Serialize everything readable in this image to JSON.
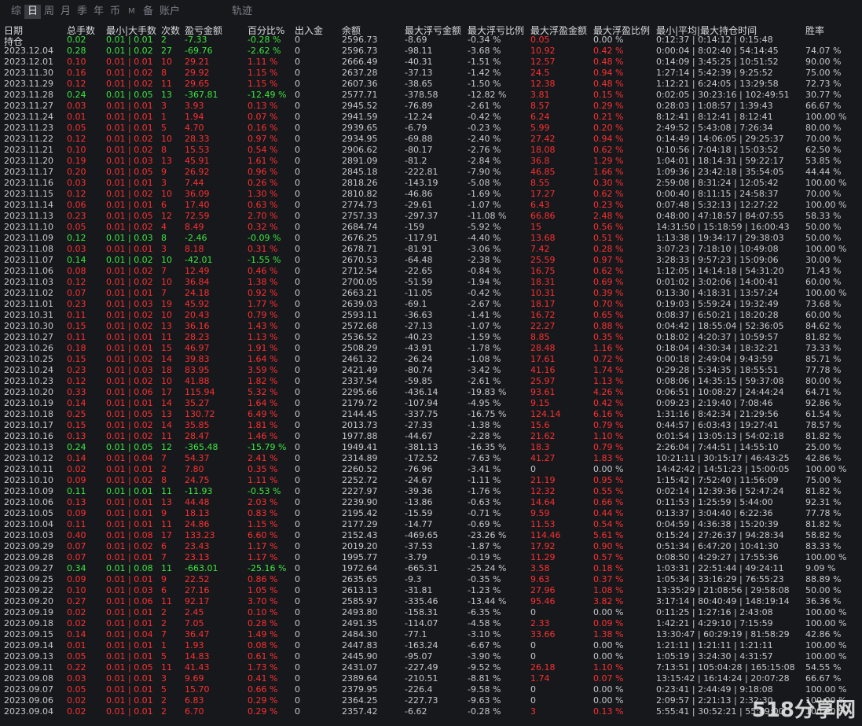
{
  "tabs": [
    "综",
    "日",
    "周",
    "月",
    "季",
    "年",
    "币",
    "M",
    "备",
    "账户",
    "轨迹"
  ],
  "active_tab": "日",
  "headers": [
    "日期",
    "总手数",
    "最小|大手数",
    "次数",
    "盈亏金额",
    "百分比%",
    "出入金",
    "余额",
    "最大浮亏金额",
    "最大浮亏比例",
    "最大浮盈金额",
    "最大浮盈比例",
    "最小|平均|最大持仓时间",
    "胜率"
  ],
  "holding": {
    "label": "持仓",
    "lots": "0.02",
    "minmax": "0.01 | 0.01",
    "count": "2",
    "pnl": "-7.33",
    "pct": "-0.28 %",
    "io": "0",
    "bal": "2596.73",
    "mfl": "-8.69",
    "mflp": "-0.34 %",
    "mfp": "0.05",
    "mfpp": "0.00 %",
    "time": "0:12:37 | 0:14:12 | 0:15:48",
    "win": ""
  },
  "rows": [
    [
      "2023.12.04",
      "0.28",
      "0.01 | 0.02",
      "27",
      "-69.76",
      "-2.62 %",
      "0",
      "2596.73",
      "-98.11",
      "-3.68 %",
      "10.92",
      "0.42 %",
      "0:00:04 | 8:02:40 | 54:14:45",
      "74.07 %"
    ],
    [
      "2023.12.01",
      "0.10",
      "0.01 | 0.01",
      "10",
      "29.21",
      "1.11 %",
      "0",
      "2666.49",
      "-40.31",
      "-1.51 %",
      "12.57",
      "0.48 %",
      "0:14:09 | 3:45:25 | 10:51:52",
      "90.00 %"
    ],
    [
      "2023.11.30",
      "0.16",
      "0.01 | 0.02",
      "8",
      "29.92",
      "1.15 %",
      "0",
      "2637.28",
      "-37.13",
      "-1.42 %",
      "24.5",
      "0.94 %",
      "1:27:14 | 5:42:39 | 9:25:52",
      "75.00 %"
    ],
    [
      "2023.11.29",
      "0.12",
      "0.01 | 0.02",
      "11",
      "29.65",
      "1.15 %",
      "0",
      "2607.36",
      "-38.65",
      "-1.50 %",
      "12.38",
      "0.48 %",
      "1:12:21 | 6:24:05 | 13:29:58",
      "72.73 %"
    ],
    [
      "2023.11.28",
      "0.24",
      "0.01 | 0.05",
      "13",
      "-367.81",
      "-12.49 %",
      "0",
      "2577.71",
      "-378.58",
      "-12.82 %",
      "3.81",
      "0.15 %",
      "0:02:05 | 30:23:16 | 102:49:51",
      "30.77 %"
    ],
    [
      "2023.11.27",
      "0.03",
      "0.01 | 0.01",
      "3",
      "3.93",
      "0.13 %",
      "0",
      "2945.52",
      "-76.89",
      "-2.61 %",
      "8.57",
      "0.29 %",
      "0:28:03 | 1:08:57 | 1:39:43",
      "66.67 %"
    ],
    [
      "2023.11.24",
      "0.01",
      "0.01 | 0.01",
      "1",
      "1.94",
      "0.07 %",
      "0",
      "2941.59",
      "-12.24",
      "-0.42 %",
      "6.24",
      "0.21 %",
      "8:12:41 | 8:12:41 | 8:12:41",
      "100.00 %"
    ],
    [
      "2023.11.23",
      "0.05",
      "0.01 | 0.01",
      "5",
      "4.70",
      "0.16 %",
      "0",
      "2939.65",
      "-6.79",
      "-0.23 %",
      "5.99",
      "0.20 %",
      "2:49:52 | 5:43:08 | 7:26:34",
      "80.00 %"
    ],
    [
      "2023.11.22",
      "0.12",
      "0.01 | 0.02",
      "10",
      "28.33",
      "0.97 %",
      "0",
      "2934.95",
      "-69.88",
      "-2.40 %",
      "27.42",
      "0.94 %",
      "0:14:49 | 14:06:05 | 29:25:37",
      "70.00 %"
    ],
    [
      "2023.11.21",
      "0.10",
      "0.01 | 0.02",
      "8",
      "15.53",
      "0.54 %",
      "0",
      "2906.62",
      "-80.17",
      "-2.76 %",
      "18.08",
      "0.62 %",
      "0:10:56 | 7:04:18 | 15:03:52",
      "62.50 %"
    ],
    [
      "2023.11.20",
      "0.19",
      "0.01 | 0.03",
      "13",
      "45.91",
      "1.61 %",
      "0",
      "2891.09",
      "-81.2",
      "-2.84 %",
      "36.8",
      "1.29 %",
      "1:04:01 | 18:14:31 | 59:22:17",
      "53.85 %"
    ],
    [
      "2023.11.17",
      "0.20",
      "0.01 | 0.05",
      "9",
      "26.92",
      "0.96 %",
      "0",
      "2845.18",
      "-222.81",
      "-7.90 %",
      "46.85",
      "1.66 %",
      "1:09:36 | 23:42:18 | 35:54:05",
      "44.44 %"
    ],
    [
      "2023.11.16",
      "0.03",
      "0.01 | 0.01",
      "3",
      "7.44",
      "0.26 %",
      "0",
      "2818.26",
      "-143.19",
      "-5.08 %",
      "8.55",
      "0.30 %",
      "2:59:08 | 8:31:24 | 12:05:42",
      "100.00 %"
    ],
    [
      "2023.11.15",
      "0.12",
      "0.01 | 0.02",
      "10",
      "36.09",
      "1.30 %",
      "0",
      "2810.82",
      "-46.86",
      "-1.69 %",
      "17.27",
      "0.62 %",
      "0:00:40 | 8:11:15 | 24:58:37",
      "70.00 %"
    ],
    [
      "2023.11.14",
      "0.06",
      "0.01 | 0.01",
      "6",
      "17.40",
      "0.63 %",
      "0",
      "2774.73",
      "-29.61",
      "-1.07 %",
      "6.43",
      "0.23 %",
      "0:07:48 | 5:32:13 | 12:27:22",
      "100.00 %"
    ],
    [
      "2023.11.13",
      "0.23",
      "0.01 | 0.05",
      "12",
      "72.59",
      "2.70 %",
      "0",
      "2757.33",
      "-297.37",
      "-11.08 %",
      "66.86",
      "2.48 %",
      "0:48:00 | 47:18:57 | 84:07:55",
      "58.33 %"
    ],
    [
      "2023.11.10",
      "0.05",
      "0.01 | 0.02",
      "4",
      "8.49",
      "0.32 %",
      "0",
      "2684.74",
      "-159",
      "-5.92 %",
      "15",
      "0.56 %",
      "14:31:50 | 15:18:59 | 16:00:43",
      "50.00 %"
    ],
    [
      "2023.11.09",
      "0.12",
      "0.01 | 0.03",
      "8",
      "-2.46",
      "-0.09 %",
      "0",
      "2676.25",
      "-117.91",
      "-4.40 %",
      "13.68",
      "0.51 %",
      "1:13:38 | 19:34:17 | 29:38:03",
      "50.00 %"
    ],
    [
      "2023.11.08",
      "0.03",
      "0.01 | 0.01",
      "3",
      "8.18",
      "0.31 %",
      "0",
      "2678.71",
      "-81.91",
      "-3.06 %",
      "7.42",
      "0.28 %",
      "3:07:23 | 7:18:10 | 10:49:08",
      "100.00 %"
    ],
    [
      "2023.11.07",
      "0.14",
      "0.01 | 0.02",
      "10",
      "-42.01",
      "-1.55 %",
      "0",
      "2670.53",
      "-64.48",
      "-2.38 %",
      "25.59",
      "0.97 %",
      "3:28:33 | 9:57:23 | 15:09:06",
      "30.00 %"
    ],
    [
      "2023.11.06",
      "0.08",
      "0.01 | 0.02",
      "7",
      "12.49",
      "0.46 %",
      "0",
      "2712.54",
      "-22.65",
      "-0.84 %",
      "16.75",
      "0.62 %",
      "1:12:05 | 14:14:18 | 54:31:20",
      "71.43 %"
    ],
    [
      "2023.11.03",
      "0.12",
      "0.01 | 0.02",
      "10",
      "36.84",
      "1.38 %",
      "0",
      "2700.05",
      "-51.59",
      "-1.94 %",
      "18.31",
      "0.69 %",
      "0:01:02 | 3:02:06 | 14:00:41",
      "60.00 %"
    ],
    [
      "2023.11.02",
      "0.07",
      "0.01 | 0.01",
      "7",
      "24.18",
      "0.92 %",
      "0",
      "2663.21",
      "-11.05",
      "-0.42 %",
      "10.31",
      "0.39 %",
      "0:13:30 | 4:18:31 | 13:57:24",
      "100.00 %"
    ],
    [
      "2023.11.01",
      "0.23",
      "0.01 | 0.03",
      "19",
      "45.92",
      "1.77 %",
      "0",
      "2639.03",
      "-69.1",
      "-2.67 %",
      "18.17",
      "0.70 %",
      "0:19:03 | 5:59:24 | 19:32:49",
      "73.68 %"
    ],
    [
      "2023.10.31",
      "0.11",
      "0.01 | 0.02",
      "10",
      "20.43",
      "0.79 %",
      "0",
      "2593.11",
      "-36.63",
      "-1.41 %",
      "16.72",
      "0.65 %",
      "0:08:37 | 6:50:21 | 18:20:28",
      "60.00 %"
    ],
    [
      "2023.10.30",
      "0.15",
      "0.01 | 0.02",
      "13",
      "36.16",
      "1.43 %",
      "0",
      "2572.68",
      "-27.13",
      "-1.07 %",
      "22.27",
      "0.88 %",
      "0:04:42 | 18:55:04 | 52:36:05",
      "84.62 %"
    ],
    [
      "2023.10.27",
      "0.11",
      "0.01 | 0.01",
      "11",
      "28.23",
      "1.13 %",
      "0",
      "2536.52",
      "-40.23",
      "-1.59 %",
      "8.85",
      "0.35 %",
      "0:18:02 | 4:20:37 | 10:59:57",
      "81.82 %"
    ],
    [
      "2023.10.26",
      "0.18",
      "0.01 | 0.01",
      "15",
      "46.97",
      "1.91 %",
      "0",
      "2508.29",
      "-43.91",
      "-1.78 %",
      "28.48",
      "1.16 %",
      "0:18:04 | 4:30:34 | 18:32:21",
      "73.33 %"
    ],
    [
      "2023.10.25",
      "0.15",
      "0.01 | 0.02",
      "14",
      "39.83",
      "1.64 %",
      "0",
      "2461.32",
      "-26.24",
      "-1.08 %",
      "17.61",
      "0.72 %",
      "0:00:18 | 2:49:04 | 9:43:59",
      "85.71 %"
    ],
    [
      "2023.10.24",
      "0.23",
      "0.01 | 0.03",
      "18",
      "83.95",
      "3.59 %",
      "0",
      "2421.49",
      "-80.74",
      "-3.42 %",
      "41.16",
      "1.74 %",
      "0:29:28 | 5:34:35 | 18:55:51",
      "77.78 %"
    ],
    [
      "2023.10.23",
      "0.12",
      "0.01 | 0.02",
      "10",
      "41.88",
      "1.82 %",
      "0",
      "2337.54",
      "-59.85",
      "-2.61 %",
      "25.97",
      "1.13 %",
      "0:08:06 | 14:35:15 | 59:37:08",
      "80.00 %"
    ],
    [
      "2023.10.20",
      "0.33",
      "0.01 | 0.06",
      "17",
      "115.94",
      "5.32 %",
      "0",
      "2295.66",
      "-436.14",
      "-19.83 %",
      "93.61",
      "4.26 %",
      "0:06:51 | 10:08:27 | 24:44:24",
      "64.71 %"
    ],
    [
      "2023.10.19",
      "0.14",
      "0.01 | 0.01",
      "14",
      "35.27",
      "1.64 %",
      "0",
      "2179.72",
      "-107.94",
      "-4.95 %",
      "9.15",
      "0.42 %",
      "0:09:23 | 2:19:40 | 7:08:46",
      "92.86 %"
    ],
    [
      "2023.10.18",
      "0.25",
      "0.01 | 0.05",
      "13",
      "130.72",
      "6.49 %",
      "0",
      "2144.45",
      "-337.75",
      "-16.75 %",
      "124.14",
      "6.16 %",
      "1:31:16 | 8:42:34 | 21:29:56",
      "61.54 %"
    ],
    [
      "2023.10.17",
      "0.15",
      "0.01 | 0.02",
      "14",
      "35.85",
      "1.81 %",
      "0",
      "2013.73",
      "-27.33",
      "-1.38 %",
      "15.6",
      "0.79 %",
      "0:44:57 | 6:03:43 | 19:27:41",
      "78.57 %"
    ],
    [
      "2023.10.16",
      "0.13",
      "0.01 | 0.02",
      "11",
      "28.47",
      "1.46 %",
      "0",
      "1977.88",
      "-44.67",
      "-2.28 %",
      "21.62",
      "1.10 %",
      "0:01:54 | 13:05:13 | 54:02:18",
      "81.82 %"
    ],
    [
      "2023.10.13",
      "0.24",
      "0.01 | 0.05",
      "12",
      "-365.48",
      "-15.79 %",
      "0",
      "1949.41",
      "-381.13",
      "-16.35 %",
      "18.3",
      "0.79 %",
      "2:26:04 | 7:44:51 | 14:55:10",
      "25.00 %"
    ],
    [
      "2023.10.12",
      "0.14",
      "0.01 | 0.04",
      "7",
      "54.37",
      "2.41 %",
      "0",
      "2314.89",
      "-172.52",
      "-7.63 %",
      "41.27",
      "1.83 %",
      "10:21:11 | 30:15:17 | 46:43:25",
      "42.86 %"
    ],
    [
      "2023.10.11",
      "0.02",
      "0.01 | 0.01",
      "2",
      "7.80",
      "0.35 %",
      "0",
      "2260.52",
      "-76.96",
      "-3.41 %",
      "0",
      "0.00 %",
      "14:42:42 | 14:51:23 | 15:00:05",
      "100.00 %"
    ],
    [
      "2023.10.10",
      "0.09",
      "0.01 | 0.02",
      "8",
      "24.75",
      "1.11 %",
      "0",
      "2252.72",
      "-24.67",
      "-1.11 %",
      "21.19",
      "0.95 %",
      "1:15:42 | 7:52:40 | 11:56:09",
      "75.00 %"
    ],
    [
      "2023.10.09",
      "0.11",
      "0.01 | 0.01",
      "11",
      "-11.93",
      "-0.53 %",
      "0",
      "2227.97",
      "-39.36",
      "-1.76 %",
      "12.32",
      "0.55 %",
      "0:02:14 | 12:39:36 | 52:47:24",
      "81.82 %"
    ],
    [
      "2023.10.06",
      "0.13",
      "0.01 | 0.01",
      "13",
      "44.48",
      "2.03 %",
      "0",
      "2239.90",
      "-13.86",
      "-0.63 %",
      "14.64",
      "0.66 %",
      "0:11:53 | 1:25:59 | 5:44:00",
      "92.31 %"
    ],
    [
      "2023.10.05",
      "0.09",
      "0.01 | 0.01",
      "9",
      "18.13",
      "0.83 %",
      "0",
      "2195.42",
      "-15.59",
      "-0.71 %",
      "9.59",
      "0.44 %",
      "0:13:37 | 3:04:40 | 6:22:36",
      "77.78 %"
    ],
    [
      "2023.10.04",
      "0.11",
      "0.01 | 0.01",
      "11",
      "24.86",
      "1.15 %",
      "0",
      "2177.29",
      "-14.77",
      "-0.69 %",
      "11.53",
      "0.54 %",
      "0:04:59 | 4:36:38 | 15:20:39",
      "81.82 %"
    ],
    [
      "2023.10.03",
      "0.40",
      "0.01 | 0.08",
      "17",
      "133.23",
      "6.60 %",
      "0",
      "2152.43",
      "-469.65",
      "-23.26 %",
      "114.46",
      "5.61 %",
      "0:15:24 | 27:26:37 | 94:28:34",
      "58.82 %"
    ],
    [
      "2023.09.29",
      "0.07",
      "0.01 | 0.02",
      "6",
      "23.43",
      "1.17 %",
      "0",
      "2019.20",
      "-37.53",
      "-1.87 %",
      "17.92",
      "0.90 %",
      "0:51:34 | 6:47:20 | 10:41:30",
      "83.33 %"
    ],
    [
      "2023.09.28",
      "0.07",
      "0.01 | 0.01",
      "7",
      "23.13",
      "1.17 %",
      "0",
      "1995.77",
      "-3.79",
      "-0.19 %",
      "11.29",
      "0.57 %",
      "0:08:50 | 4:29:27 | 17:55:36",
      "100.00 %"
    ],
    [
      "2023.09.27",
      "0.34",
      "0.01 | 0.08",
      "11",
      "-663.01",
      "-25.16 %",
      "0",
      "1972.64",
      "-665.31",
      "-25.24 %",
      "3.58",
      "0.18 %",
      "1:03:31 | 22:51:44 | 49:24:11",
      "9.09 %"
    ],
    [
      "2023.09.25",
      "0.09",
      "0.01 | 0.01",
      "9",
      "22.52",
      "0.86 %",
      "0",
      "2635.65",
      "-9.3",
      "-0.35 %",
      "9.63",
      "0.37 %",
      "1:05:34 | 33:16:29 | 76:55:23",
      "88.89 %"
    ],
    [
      "2023.09.22",
      "0.10",
      "0.01 | 0.03",
      "6",
      "27.16",
      "1.05 %",
      "0",
      "2613.13",
      "-31.81",
      "-1.23 %",
      "27.96",
      "1.08 %",
      "13:35:29 | 21:08:56 | 29:58:08",
      "50.00 %"
    ],
    [
      "2023.09.20",
      "0.27",
      "0.01 | 0.06",
      "11",
      "92.17",
      "3.70 %",
      "0",
      "2585.97",
      "-335.46",
      "-13.44 %",
      "95.46",
      "3.82 %",
      "3:17:14 | 80:40:49 | 148:19:14",
      "36.36 %"
    ],
    [
      "2023.09.19",
      "0.02",
      "0.01 | 0.01",
      "2",
      "2.45",
      "0.10 %",
      "0",
      "2493.80",
      "-158.31",
      "-6.35 %",
      "0",
      "0.00 %",
      "0:11:25 | 1:27:16 | 2:43:08",
      "100.00 %"
    ],
    [
      "2023.09.18",
      "0.02",
      "0.01 | 0.01",
      "2",
      "7.05",
      "0.28 %",
      "0",
      "2491.35",
      "-114.07",
      "-4.58 %",
      "2.33",
      "0.09 %",
      "1:42:21 | 4:29:10 | 7:15:59",
      "100.00 %"
    ],
    [
      "2023.09.15",
      "0.14",
      "0.01 | 0.04",
      "7",
      "36.47",
      "1.49 %",
      "0",
      "2484.30",
      "-77.1",
      "-3.10 %",
      "33.66",
      "1.38 %",
      "13:30:47 | 60:29:19 | 81:58:29",
      "42.86 %"
    ],
    [
      "2023.09.14",
      "0.01",
      "0.01 | 0.01",
      "1",
      "1.93",
      "0.08 %",
      "0",
      "2447.83",
      "-163.24",
      "-6.67 %",
      "0",
      "0.00 %",
      "1:21:11 | 1:21:11 | 1:21:11",
      "100.00 %"
    ],
    [
      "2023.09.13",
      "0.05",
      "0.01 | 0.01",
      "5",
      "14.83",
      "0.61 %",
      "0",
      "2445.90",
      "-95.07",
      "-3.90 %",
      "0",
      "0.00 %",
      "1:05:19 | 3:24:30 | 4:31:57",
      "100.00 %"
    ],
    [
      "2023.09.11",
      "0.22",
      "0.01 | 0.05",
      "11",
      "41.43",
      "1.73 %",
      "0",
      "2431.07",
      "-227.49",
      "-9.52 %",
      "26.18",
      "1.10 %",
      "7:13:51 | 105:04:28 | 165:15:08",
      "54.55 %"
    ],
    [
      "2023.09.08",
      "0.03",
      "0.01 | 0.01",
      "3",
      "9.69",
      "0.41 %",
      "0",
      "2389.64",
      "-210.51",
      "-8.81 %",
      "1.74",
      "0.07 %",
      "13:15:42 | 16:14:24 | 20:07:28",
      "66.67 %"
    ],
    [
      "2023.09.07",
      "0.05",
      "0.01 | 0.01",
      "5",
      "15.70",
      "0.66 %",
      "0",
      "2379.95",
      "-226.4",
      "-9.58 %",
      "0",
      "0.00 %",
      "0:23:41 | 2:44:49 | 9:18:08",
      "100.00 %"
    ],
    [
      "2023.09.06",
      "0.02",
      "0.01 | 0.01",
      "2",
      "6.83",
      "0.29 %",
      "0",
      "2364.25",
      "-227.73",
      "-9.63 %",
      "0",
      "0.00 %",
      "2:09:57 | 2:21:13 | 2:32:30",
      "100.00 %"
    ],
    [
      "2023.09.04",
      "0.02",
      "0.01 | 0.01",
      "2",
      "6.70",
      "0.29 %",
      "0",
      "2357.42",
      "-6.62",
      "-0.28 %",
      "3",
      "0.13 %",
      "5:55:41 | 30:52:21 | 55:49:00",
      "100.00 %"
    ]
  ],
  "watermark": "518分享网"
}
